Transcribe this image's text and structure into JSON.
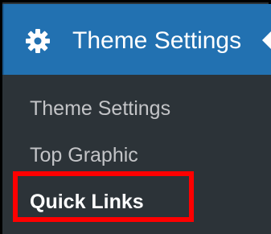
{
  "menu": {
    "top_label": "Theme Settings",
    "top_icon": "gear-icon",
    "accent_color": "#2271b1",
    "submenu": [
      {
        "label": "Theme Settings"
      },
      {
        "label": "Top Graphic"
      },
      {
        "label": "Quick Links",
        "current": true
      }
    ]
  },
  "annotation": {
    "highlight_color": "#ff0000",
    "highlighted_item": "Quick Links"
  }
}
